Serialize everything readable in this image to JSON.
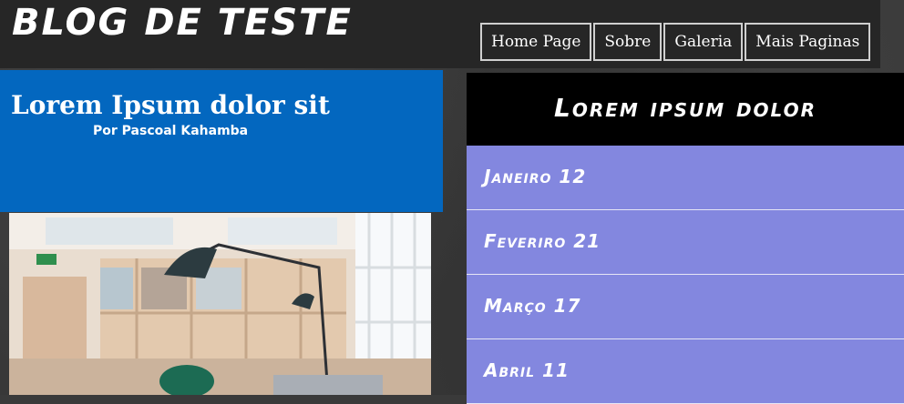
{
  "header": {
    "site_title": "Blog de Teste",
    "nav": [
      "Home Page",
      "Sobre",
      "Galeria",
      "Mais Paginas"
    ]
  },
  "post": {
    "title": "Lorem Ipsum dolor sit",
    "author": "Por Pascoal Kahamba",
    "image_name": "office-interior-photo"
  },
  "sidebar": {
    "title": "Lorem ipsum dolor",
    "items": [
      {
        "label": "Janeiro 12"
      },
      {
        "label": "Feveriro 21"
      },
      {
        "label": "Março 17"
      },
      {
        "label": "Abril 11"
      }
    ]
  },
  "colors": {
    "header_bg": "#262626",
    "post_header_bg": "#0367bf",
    "sidebar_head_bg": "#000000",
    "sidebar_item_bg": "#8387df"
  }
}
